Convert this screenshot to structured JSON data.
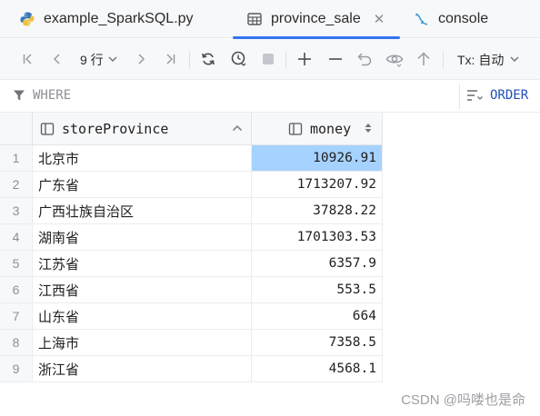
{
  "tabs": [
    {
      "label": "example_SparkSQL.py",
      "icon": "python-icon",
      "active": false
    },
    {
      "label": "province_sale",
      "icon": "table-icon",
      "active": true,
      "closable": true
    },
    {
      "label": "console",
      "icon": "console-icon",
      "active": false
    }
  ],
  "colors": {
    "accent": "#3574f0",
    "selection": "#a6d2ff",
    "order_text": "#1f4fb5"
  },
  "toolbar": {
    "row_count": "9 行",
    "tx_mode": "Tx: 自动",
    "buttons": [
      "first-page",
      "previous-page",
      "next-page",
      "last-page",
      "reload",
      "history",
      "stop",
      "add-row",
      "delete-row",
      "revert",
      "preview",
      "submit"
    ]
  },
  "filter": {
    "where_label": "WHERE",
    "order_label": "ORDER"
  },
  "table": {
    "columns": [
      "storeProvince",
      "money"
    ],
    "rows": [
      {
        "num": "1",
        "storeProvince": "北京市",
        "money": "10926.91"
      },
      {
        "num": "2",
        "storeProvince": "广东省",
        "money": "1713207.92"
      },
      {
        "num": "3",
        "storeProvince": "广西壮族自治区",
        "money": "37828.22"
      },
      {
        "num": "4",
        "storeProvince": "湖南省",
        "money": "1701303.53"
      },
      {
        "num": "5",
        "storeProvince": "江苏省",
        "money": "6357.9"
      },
      {
        "num": "6",
        "storeProvince": "江西省",
        "money": "553.5"
      },
      {
        "num": "7",
        "storeProvince": "山东省",
        "money": "664"
      },
      {
        "num": "8",
        "storeProvince": "上海市",
        "money": "7358.5"
      },
      {
        "num": "9",
        "storeProvince": "浙江省",
        "money": "4568.1"
      }
    ],
    "selected_cell": {
      "row": 1,
      "column": "money"
    }
  },
  "watermark": "CSDN @吗喽也是命"
}
